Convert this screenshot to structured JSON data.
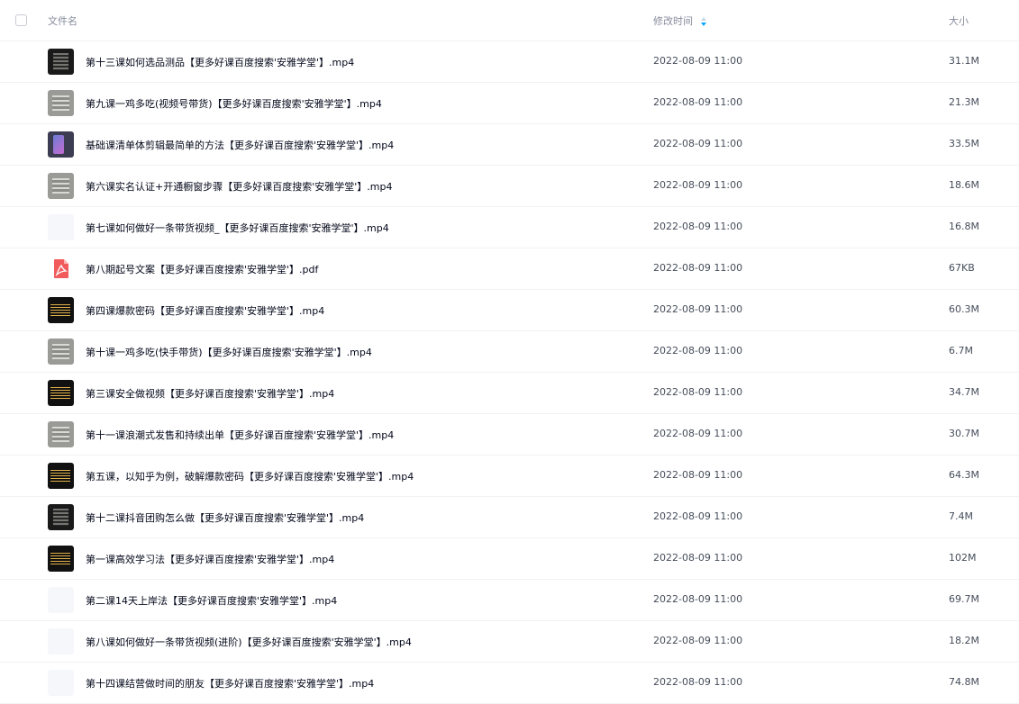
{
  "header": {
    "name_label": "文件名",
    "time_label": "修改时间",
    "size_label": "大小"
  },
  "colors": {
    "accent": "#06a7ff",
    "pdf": "#f25b5b",
    "row_border": "#f1f2f4"
  },
  "files": [
    {
      "name": "第十三课如何选品测品【更多好课百度搜索'安雅学堂'】.mp4",
      "time": "2022-08-09 11:00",
      "size": "31.1M",
      "thumb": "dark"
    },
    {
      "name": "第九课一鸡多吃(视频号带货)【更多好课百度搜索'安雅学堂'】.mp4",
      "time": "2022-08-09 11:00",
      "size": "21.3M",
      "thumb": "gray"
    },
    {
      "name": "基础课清单体剪辑最简单的方法【更多好课百度搜索'安雅学堂'】.mp4",
      "time": "2022-08-09 11:00",
      "size": "33.5M",
      "thumb": "phone"
    },
    {
      "name": "第六课实名认证+开通橱窗步骤【更多好课百度搜索'安雅学堂'】.mp4",
      "time": "2022-08-09 11:00",
      "size": "18.6M",
      "thumb": "gray"
    },
    {
      "name": "第七课如何做好一条带货视频_【更多好课百度搜索'安雅学堂'】.mp4",
      "time": "2022-08-09 11:00",
      "size": "16.8M",
      "thumb": "blank"
    },
    {
      "name": "第八期起号文案【更多好课百度搜索'安雅学堂'】.pdf",
      "time": "2022-08-09 11:00",
      "size": "67KB",
      "thumb": "pdf"
    },
    {
      "name": "第四课爆款密码【更多好课百度搜索'安雅学堂'】.mp4",
      "time": "2022-08-09 11:00",
      "size": "60.3M",
      "thumb": "term"
    },
    {
      "name": "第十课一鸡多吃(快手带货)【更多好课百度搜索'安雅学堂'】.mp4",
      "time": "2022-08-09 11:00",
      "size": "6.7M",
      "thumb": "gray"
    },
    {
      "name": "第三课安全做视频【更多好课百度搜索'安雅学堂'】.mp4",
      "time": "2022-08-09 11:00",
      "size": "34.7M",
      "thumb": "term"
    },
    {
      "name": "第十一课浪潮式发售和持续出单【更多好课百度搜索'安雅学堂'】.mp4",
      "time": "2022-08-09 11:00",
      "size": "30.7M",
      "thumb": "gray"
    },
    {
      "name": "第五课，以知乎为例，破解爆款密码【更多好课百度搜索'安雅学堂'】.mp4",
      "time": "2022-08-09 11:00",
      "size": "64.3M",
      "thumb": "term"
    },
    {
      "name": "第十二课抖音团购怎么做【更多好课百度搜索'安雅学堂'】.mp4",
      "time": "2022-08-09 11:00",
      "size": "7.4M",
      "thumb": "dark"
    },
    {
      "name": "第一课高效学习法【更多好课百度搜索'安雅学堂'】.mp4",
      "time": "2022-08-09 11:00",
      "size": "102M",
      "thumb": "term"
    },
    {
      "name": "第二课14天上岸法【更多好课百度搜索'安雅学堂'】.mp4",
      "time": "2022-08-09 11:00",
      "size": "69.7M",
      "thumb": "blank"
    },
    {
      "name": "第八课如何做好一条带货视频(进阶)【更多好课百度搜索'安雅学堂'】.mp4",
      "time": "2022-08-09 11:00",
      "size": "18.2M",
      "thumb": "blank"
    },
    {
      "name": "第十四课结营做时间的朋友【更多好课百度搜索'安雅学堂'】.mp4",
      "time": "2022-08-09 11:00",
      "size": "74.8M",
      "thumb": "blank"
    }
  ]
}
